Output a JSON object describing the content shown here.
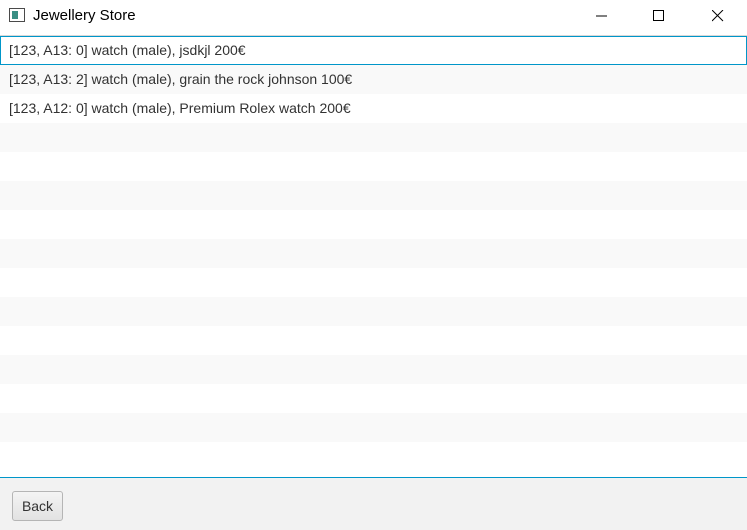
{
  "window": {
    "title": "Jewellery Store"
  },
  "list": {
    "items": [
      {
        "label": "[123, A13: 0] watch (male), jsdkjl 200€",
        "selected": true
      },
      {
        "label": "[123, A13: 2] watch (male), grain the rock johnson 100€",
        "selected": false
      },
      {
        "label": "[123, A12: 0] watch (male), Premium Rolex watch 200€",
        "selected": false
      }
    ]
  },
  "footer": {
    "back_label": "Back"
  },
  "colors": {
    "selection_border": "#0096c9",
    "stripe": "#f9f9f9",
    "footer_bg": "#f2f2f2"
  }
}
